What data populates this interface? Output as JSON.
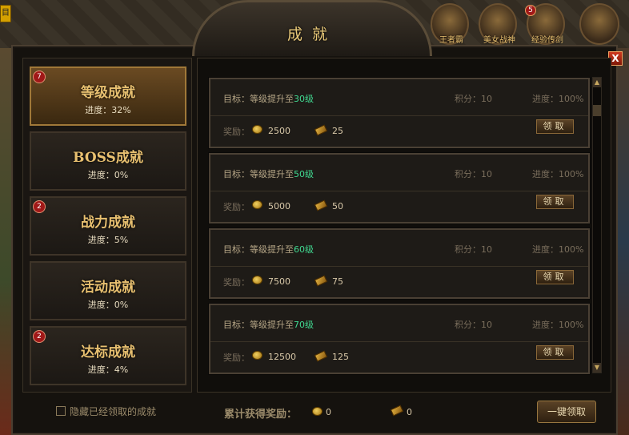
{
  "window": {
    "title": "成就",
    "close_label": "X"
  },
  "top_icons": [
    {
      "label": "王者霸",
      "badge": ""
    },
    {
      "label": "美女战神",
      "badge": ""
    },
    {
      "label": "经验传剑",
      "badge": "5"
    }
  ],
  "categories": [
    {
      "name": "等级成就",
      "progress": "进度：32%",
      "badge": "7",
      "active": true
    },
    {
      "name": "BOSS成就",
      "progress": "进度：0%",
      "badge": ""
    },
    {
      "name": "战力成就",
      "progress": "进度：5%",
      "badge": "2"
    },
    {
      "name": "活动成就",
      "progress": "进度：0%",
      "badge": ""
    },
    {
      "name": "达标成就",
      "progress": "进度：4%",
      "badge": "2"
    }
  ],
  "achievements": [
    {
      "target_prefix": "目标：等级提升至",
      "level": "30级",
      "score": "积分：10",
      "progress": "进度：100%",
      "reward_label": "奖励：",
      "gold": "2500",
      "yuanbao": "25",
      "button": "领取"
    },
    {
      "target_prefix": "目标：等级提升至",
      "level": "50级",
      "score": "积分：10",
      "progress": "进度：100%",
      "reward_label": "奖励：",
      "gold": "5000",
      "yuanbao": "50",
      "button": "领取"
    },
    {
      "target_prefix": "目标：等级提升至",
      "level": "60级",
      "score": "积分：10",
      "progress": "进度：100%",
      "reward_label": "奖励：",
      "gold": "7500",
      "yuanbao": "75",
      "button": "领取"
    },
    {
      "target_prefix": "目标：等级提升至",
      "level": "70级",
      "score": "积分：10",
      "progress": "进度：100%",
      "reward_label": "奖励：",
      "gold": "12500",
      "yuanbao": "125",
      "button": "领取"
    }
  ],
  "footer": {
    "hide_claimed_label": "隐藏已经领取的成就",
    "total_label": "累计获得奖励：",
    "total_gold": "0",
    "total_yuanbao": "0",
    "claim_all_label": "一键领取"
  },
  "colors": {
    "accent_gold": "#e8c070",
    "level_green": "#40d890",
    "badge_red": "#a01818"
  }
}
